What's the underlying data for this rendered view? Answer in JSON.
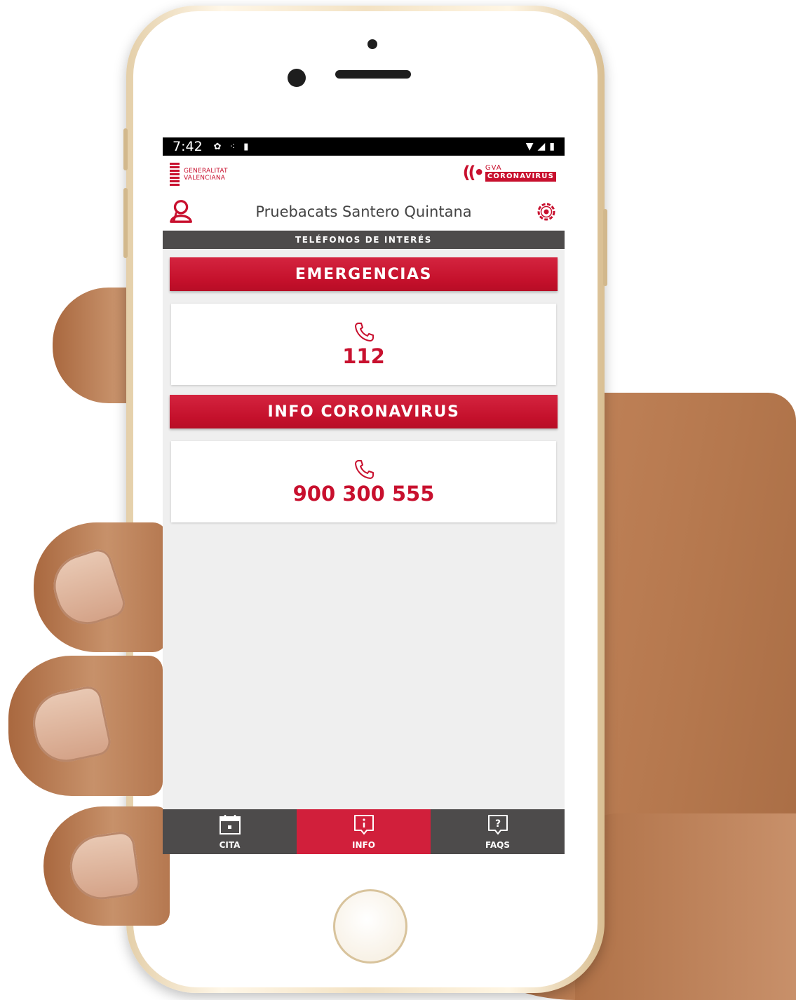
{
  "status_bar": {
    "time": "7:42"
  },
  "branding": {
    "gv_line1": "GENERALITAT",
    "gv_line2": "VALENCIANA",
    "gva_top": "GVA",
    "gva_bottom": "CORONAVIRUS"
  },
  "user": {
    "name": "Pruebacats Santero Quintana"
  },
  "section": {
    "title": "TELÉFONOS DE INTERÉS"
  },
  "categories": [
    {
      "title": "EMERGENCIAS",
      "number": "112"
    },
    {
      "title": "INFO CORONAVIRUS",
      "number": "900 300 555"
    }
  ],
  "bottom_nav": [
    {
      "label": "CITA",
      "icon": "calendar-icon",
      "active": false
    },
    {
      "label": "INFO",
      "icon": "info-icon",
      "active": true
    },
    {
      "label": "FAQS",
      "icon": "question-icon",
      "active": false
    }
  ],
  "colors": {
    "brand_red": "#c8102e",
    "nav_dark": "#4d4b4b",
    "nav_active": "#d11f3b",
    "screen_bg": "#efefef"
  }
}
